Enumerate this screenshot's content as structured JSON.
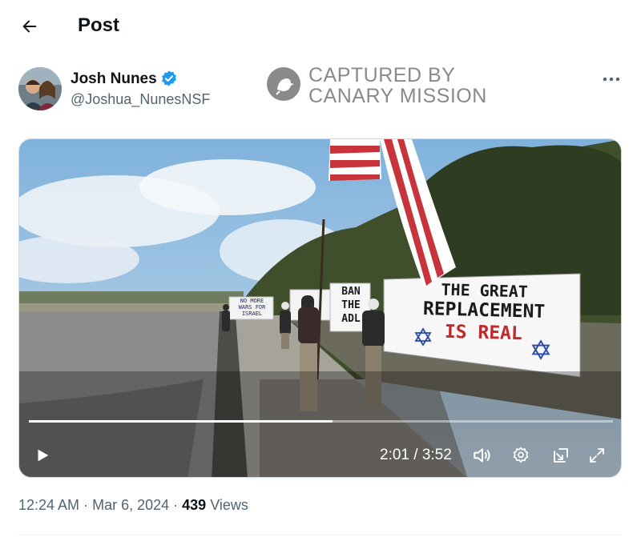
{
  "header": {
    "title": "Post"
  },
  "author": {
    "name": "Josh Nunes",
    "handle": "@Joshua_NunesNSF",
    "verified": true
  },
  "watermark": {
    "line1": "CAPTURED BY",
    "line2": "CANARY MISSION"
  },
  "video": {
    "current_time": "2:01",
    "duration": "3:52",
    "time_display": "2:01 / 3:52",
    "progress_fraction": 0.52,
    "banners": {
      "left": [
        "NO MORE",
        "WARS FOR",
        "ISRAEL"
      ],
      "middle": [
        "BAN",
        "THE",
        "ADL"
      ],
      "main": [
        "THE GREAT",
        "REPLACEMENT",
        "IS REAL"
      ]
    }
  },
  "meta": {
    "time": "12:24 AM",
    "date": "Mar 6, 2024",
    "views_count": "439",
    "views_label": "Views"
  },
  "colors": {
    "accent": "#1d9bf0",
    "text": "#0f1419",
    "secondary": "#536471"
  }
}
